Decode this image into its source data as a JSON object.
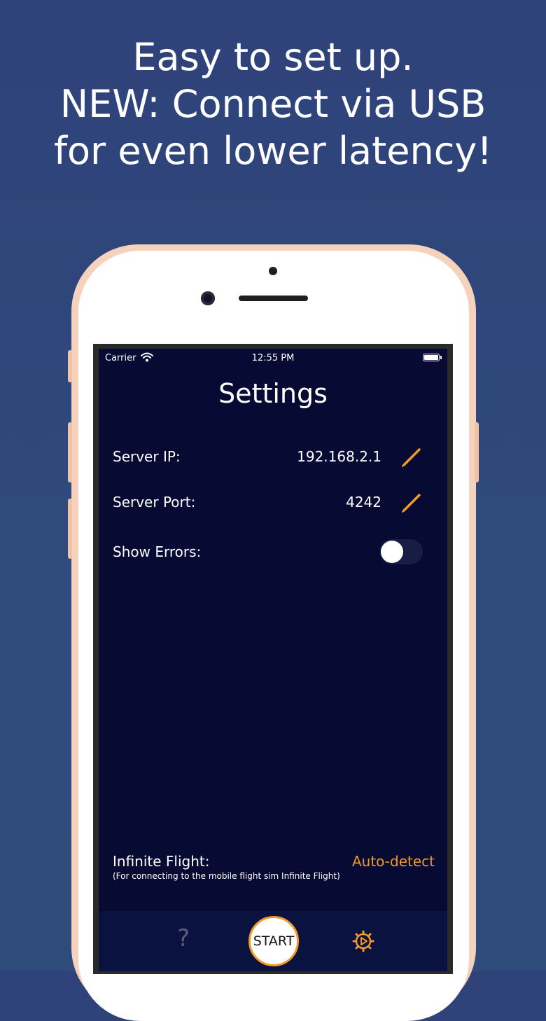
{
  "headline": {
    "line1": "Easy to set up.",
    "line2": "NEW: Connect via USB",
    "line3": "for even lower latency!"
  },
  "status_bar": {
    "carrier": "Carrier",
    "time": "12:55 PM",
    "icons": [
      "wifi-icon",
      "battery-icon"
    ]
  },
  "screen": {
    "title": "Settings",
    "server_ip": {
      "label": "Server IP:",
      "value": "192.168.2.1",
      "edit_icon": "pencil-icon"
    },
    "server_port": {
      "label": "Server Port:",
      "value": "4242",
      "edit_icon": "pencil-icon"
    },
    "show_errors": {
      "label": "Show Errors:",
      "enabled": false
    },
    "infinite_flight": {
      "label": "Infinite Flight:",
      "note": "(For connecting to the mobile flight sim Infinite Flight)",
      "action": "Auto-detect"
    }
  },
  "tab_bar": {
    "help_label": "?",
    "start_label": "START",
    "settings_icon": "gear-icon"
  },
  "colors": {
    "background": "#2f4579",
    "screen": "#070a33",
    "accent": "#f19a25",
    "phone_frame": "#f6d2bd"
  }
}
